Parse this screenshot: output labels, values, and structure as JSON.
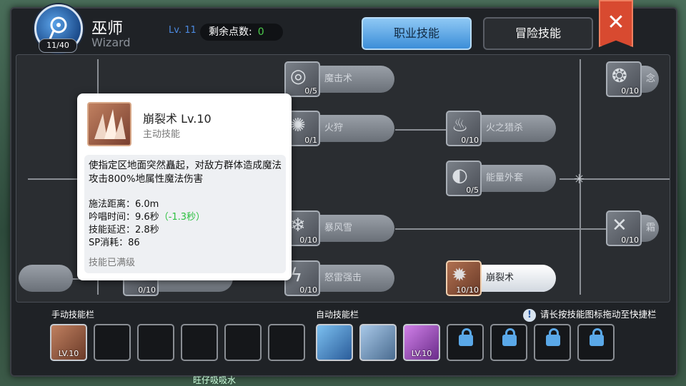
{
  "header": {
    "job_name": "巫师",
    "job_name_en": "Wizard",
    "job_level": "Lv. 11",
    "class_progress": "11/40",
    "points_label": "剩余点数:",
    "points_value": "0"
  },
  "tabs": [
    {
      "label": "职业技能",
      "active": true
    },
    {
      "label": "冒险技能",
      "active": false
    }
  ],
  "close_icon": "close-icon",
  "skills": [
    {
      "name": "魔击术",
      "level": "0/5",
      "icon": "magic-strike-icon"
    },
    {
      "name": "火狩",
      "level": "0/1",
      "icon": "fire-hunt-icon"
    },
    {
      "name": "火之猎杀",
      "level": "0/10",
      "icon": "fire-slaughter-icon"
    },
    {
      "name": "能量外套",
      "level": "0/5",
      "icon": "energy-coat-icon"
    },
    {
      "name": "暴风雪",
      "level": "0/10",
      "icon": "storm-gust-icon"
    },
    {
      "name": "怒雷强击",
      "level": "0/10",
      "icon": "thunder-strike-icon"
    },
    {
      "name": "崩裂术",
      "level": "10/10",
      "icon": "earth-spike-icon"
    },
    {
      "name": "念",
      "level": "0/10",
      "icon": "sense-icon"
    },
    {
      "name": "霜",
      "level": "0/10",
      "icon": "frost-icon"
    },
    {
      "name": "",
      "level": "0/10",
      "icon": "skill-icon"
    }
  ],
  "tooltip": {
    "name": "崩裂术  Lv.10",
    "type": "主动技能",
    "description": "使指定区地面突然矗起，对敌方群体造成魔法攻击800%地属性魔法伤害",
    "cast_range": "施法距离：6.0m",
    "chant_time": "吟唱时间：9.6秒",
    "chant_bonus": "（-1.3秒）",
    "skill_delay": "技能延迟：2.8秒",
    "sp_cost": "SP消耗：86",
    "max_note": "技能已满级"
  },
  "manual_bar": {
    "label": "手动技能栏",
    "slots": [
      {
        "filled": true,
        "level": "LV.10",
        "icon": "earth-spike-icon"
      },
      {},
      {},
      {},
      {},
      {}
    ]
  },
  "auto_bar": {
    "label": "自动技能栏",
    "slots": [
      {
        "filled": true,
        "icon": "sword-attack-icon"
      },
      {
        "filled": true,
        "icon": "cross-shield-icon"
      },
      {
        "filled": true,
        "level": "LV.10",
        "icon": "arrow-burst-icon"
      },
      {
        "locked": true
      },
      {
        "locked": true
      },
      {
        "locked": true
      },
      {
        "locked": true
      }
    ]
  },
  "hint": "请长按技能图标拖动至快捷栏",
  "footer_text": "旺仔吸吸水",
  "colors": {
    "accent": "#3c8ed8",
    "close": "#d84a30",
    "bonus": "#2cc040",
    "lock": "#5aa8e8"
  }
}
